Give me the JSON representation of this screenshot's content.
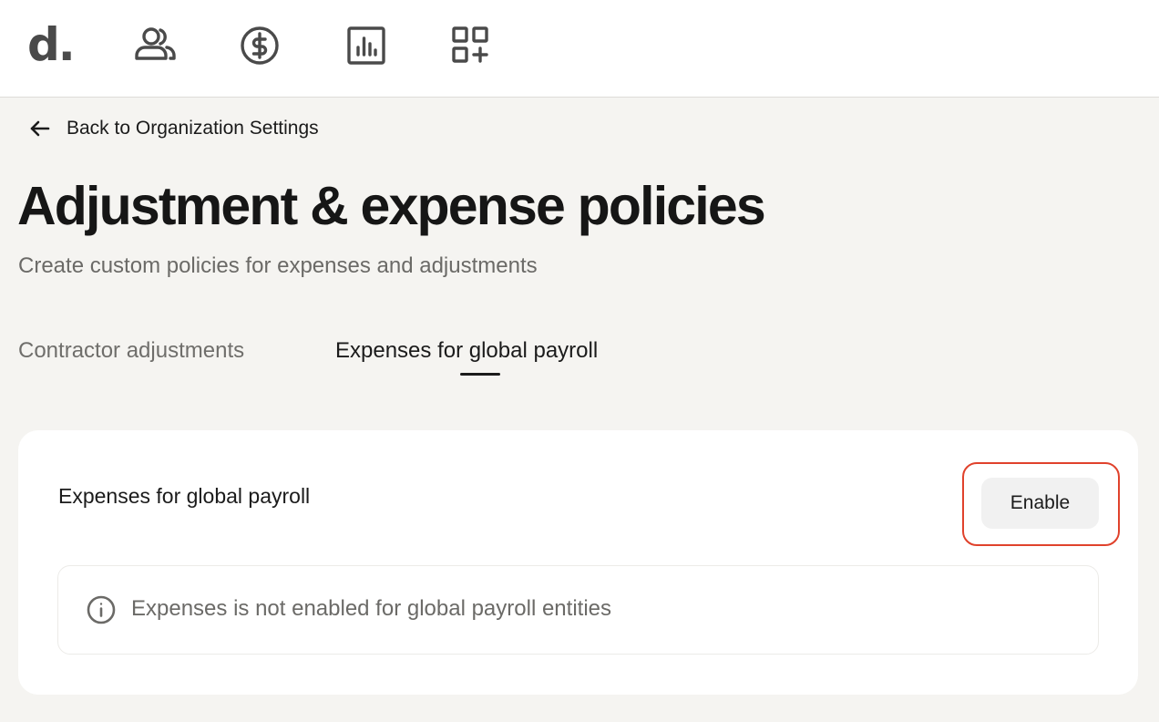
{
  "header": {
    "logo_text": "d.",
    "nav_icons": [
      "people-icon",
      "dollar-circle-icon",
      "bar-chart-icon",
      "apps-add-icon"
    ]
  },
  "back_link": {
    "label": "Back to Organization Settings",
    "icon": "arrow-left-icon"
  },
  "page": {
    "title": "Adjustment & expense policies",
    "subtitle": "Create custom policies for expenses and adjustments"
  },
  "tabs": [
    {
      "label": "Contractor adjustments",
      "active": false
    },
    {
      "label": "Expenses for global payroll",
      "active": true
    }
  ],
  "card": {
    "title": "Expenses for global payroll",
    "enable_button_label": "Enable",
    "info_icon": "info-icon",
    "info_text": "Expenses is not enabled for global payroll entities"
  },
  "colors": {
    "background": "#f5f4f1",
    "surface": "#ffffff",
    "highlight": "#e0422c",
    "muted_text": "#6b6a67"
  }
}
